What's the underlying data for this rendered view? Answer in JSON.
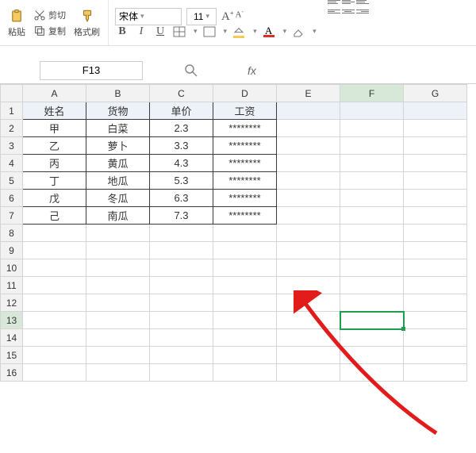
{
  "ribbon": {
    "paste_label": "粘贴",
    "cut_label": "剪切",
    "copy_label": "复制",
    "format_painter_label": "格式刷",
    "font_name": "宋体",
    "font_size": "11",
    "bold": "B",
    "italic": "I",
    "underline": "U",
    "font_letter": "A"
  },
  "namebox": {
    "ref": "F13"
  },
  "fx": {
    "label": "fx"
  },
  "columns": [
    "A",
    "B",
    "C",
    "D",
    "E",
    "F",
    "G"
  ],
  "rows": [
    "1",
    "2",
    "3",
    "4",
    "5",
    "6",
    "7",
    "8",
    "9",
    "10",
    "11",
    "12",
    "13",
    "14",
    "15",
    "16"
  ],
  "selected": {
    "col": "F",
    "row": "13"
  },
  "chart_data": {
    "type": "table",
    "headers": [
      "姓名",
      "货物",
      "单价",
      "工资"
    ],
    "records": [
      {
        "姓名": "甲",
        "货物": "白菜",
        "单价": "2.3",
        "工资": "********"
      },
      {
        "姓名": "乙",
        "货物": "萝卜",
        "单价": "3.3",
        "工资": "********"
      },
      {
        "姓名": "丙",
        "货物": "黄瓜",
        "单价": "4.3",
        "工资": "********"
      },
      {
        "姓名": "丁",
        "货物": "地瓜",
        "单价": "5.3",
        "工资": "********"
      },
      {
        "姓名": "戊",
        "货物": "冬瓜",
        "单价": "6.3",
        "工资": "********"
      },
      {
        "姓名": "己",
        "货物": "南瓜",
        "单价": "7.3",
        "工资": "********"
      }
    ]
  }
}
